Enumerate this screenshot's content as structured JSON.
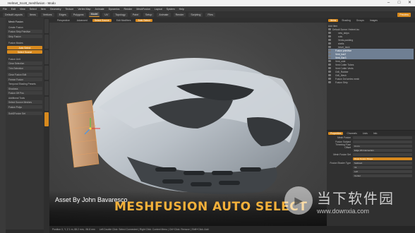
{
  "window": {
    "title": "Helmet_Scott_meshfusion - Modo",
    "controls": [
      "–",
      "□",
      "✕"
    ]
  },
  "menu": [
    "File",
    "Edit",
    "View",
    "Select",
    "Item",
    "Geometry",
    "Texture",
    "Vertex Map",
    "Animate",
    "Dynamics",
    "Render",
    "MeshFusion",
    "Layout",
    "System",
    "Help"
  ],
  "toolbar": {
    "items": [
      "Default Layouts",
      "Items",
      "Vertices",
      "Edges",
      "Polygons",
      "Model",
      "UV",
      "Topology",
      "Paint",
      "Setup",
      "Animate",
      "Render",
      "Scripting",
      "Files"
    ],
    "active": "Model",
    "preview": "Preview"
  },
  "viewport_tabs": {
    "items": [
      "Perspective",
      "Advanced",
      "Select Source",
      "Edit Modifiers",
      "Auto Select"
    ],
    "highlighted": [
      "Select Source",
      "Auto Select"
    ]
  },
  "left_panel": {
    "header": "Mesh Fusion",
    "rows": [
      {
        "label": "Create Fusion",
        "style": "plain"
      },
      {
        "label": "Fusion Strip Primitive",
        "style": "row"
      },
      {
        "label": "Strip Fusion",
        "style": "row"
      },
      {
        "label": "",
        "style": "gap"
      },
      {
        "label": "Fusion Modes",
        "style": "plain"
      },
      {
        "label": "Auto Select",
        "style": "orange"
      },
      {
        "label": "Select Source",
        "style": "orange"
      },
      {
        "label": "",
        "style": "gap"
      },
      {
        "label": "Fusion Unit",
        "style": "plain"
      },
      {
        "label": "Clear Selection",
        "style": "row"
      },
      {
        "label": "Trim Selection",
        "style": "row"
      },
      {
        "label": "",
        "style": "gap"
      },
      {
        "label": "Clear Fusion Edit",
        "style": "row"
      },
      {
        "label": "Freeze Fusion",
        "style": "row"
      },
      {
        "label": "Temporal Shading Presets",
        "style": "plain"
      },
      {
        "label": "Shadows",
        "style": "row"
      },
      {
        "label": "Fusion Off Pos",
        "style": "row"
      },
      {
        "label": "Additional Tools",
        "style": "plain"
      },
      {
        "label": "Select Source Meshes",
        "style": "row"
      },
      {
        "label": "Fusion Polys",
        "style": "row"
      },
      {
        "label": "",
        "style": "gap"
      },
      {
        "label": "SubDFusion Set",
        "style": "row"
      }
    ]
  },
  "items": {
    "tabs": [
      "Items",
      "Shading",
      "Groups",
      "Images"
    ],
    "active_tab": "Items",
    "header": "Add Item",
    "rows": [
      {
        "label": "Default Scene: Helmet.lxo",
        "indent": 0,
        "highlight": false
      },
      {
        "label": "new_strips",
        "indent": 2,
        "highlight": false
      },
      {
        "label": "cuts",
        "indent": 2,
        "highlight": false
      },
      {
        "label": "Vents-padding",
        "indent": 2,
        "highlight": false
      },
      {
        "label": "shells",
        "indent": 2,
        "highlight": false
      },
      {
        "label": "bevel_back",
        "indent": 2,
        "highlight": false
      },
      {
        "label": "Fusion primitive",
        "indent": 1,
        "highlight": true
      },
      {
        "label": "Vent_bar2",
        "indent": 1,
        "highlight": true
      },
      {
        "label": "Vent_Bar3",
        "indent": 1,
        "highlight": true
      },
      {
        "label": "Vent_side",
        "indent": 1,
        "highlight": false
      },
      {
        "label": "Vent Cutter Tubes",
        "indent": 1,
        "highlight": false
      },
      {
        "label": "Vent Cutter Vents",
        "indent": 1,
        "highlight": false
      },
      {
        "label": "Grill_Rubber",
        "indent": 1,
        "highlight": false
      },
      {
        "label": "Grill_Mesh",
        "indent": 1,
        "highlight": false
      },
      {
        "label": "Fusion 3rd series mesh",
        "indent": 1,
        "highlight": false
      },
      {
        "label": "Fusion Strip",
        "indent": 1,
        "highlight": false
      }
    ]
  },
  "properties": {
    "tabs": [
      "Properties",
      "Channels",
      "Lists",
      "Info"
    ],
    "active_tab": "Properties",
    "rows": [
      {
        "label": "Mesh Fusion",
        "value": ""
      },
      {
        "label": "Fusion Subject",
        "value": ""
      },
      {
        "label": "Trimming Fuse Offset",
        "value": "0 mm"
      },
      {
        "label": "",
        "value": "Edge Wt Intersection"
      },
      {
        "label": "Mesh Fusion Set",
        "value": ""
      },
      {
        "label": "",
        "value": "Draw Fusion Shape",
        "orange": true
      },
      {
        "label": "Fusion Shader Type",
        "value": "Subtract"
      },
      {
        "label": "",
        "value": "Int"
      },
      {
        "label": "",
        "value": "Left"
      },
      {
        "label": "",
        "value": "Center"
      }
    ]
  },
  "caption": {
    "credit": "Asset By John Bavaresco",
    "headline": "MESHFUSION AUTO SELECT"
  },
  "status": {
    "text": "Position X, Y, Z    1 m, 88.2 mm, -96.8 mm",
    "right": "Left Double Click: Select Connected | Right Click: Context Menu | Ctrl+Click: Remove | Shift+Click: Add"
  },
  "watermark": {
    "cn": "当下软件园",
    "url": "www.downxia.com"
  },
  "colors": {
    "accent": "#d88a1e",
    "headline": "#f3b03a",
    "selection": "#6f7f93"
  }
}
